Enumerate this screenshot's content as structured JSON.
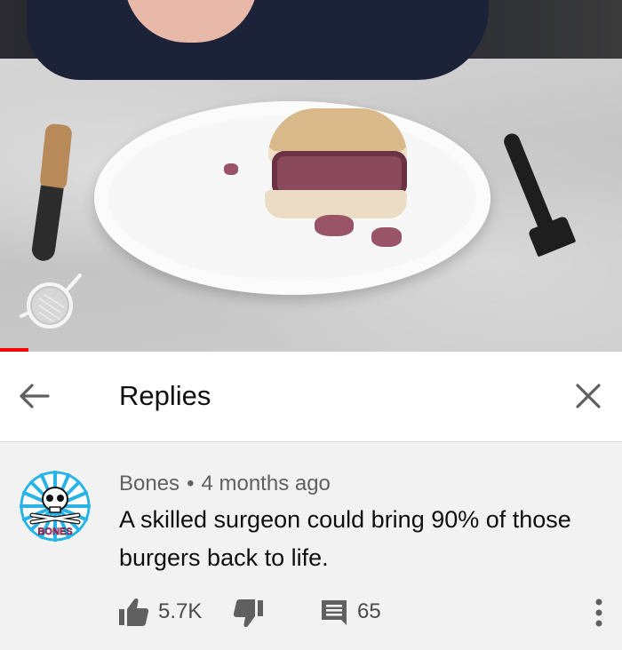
{
  "video": {
    "progress_fraction": 0.046
  },
  "replies_header": {
    "title": "Replies",
    "back_icon": "arrow-left-icon",
    "close_icon": "close-icon"
  },
  "comment": {
    "author": "Bones",
    "separator": "•",
    "time_ago": "4 months ago",
    "text": "A skilled surgeon could bring 90% of those burgers back to life.",
    "avatar_text": "BONES",
    "like_count": "5.7K",
    "reply_count": "65",
    "icons": {
      "like": "thumbs-up-icon",
      "dislike": "thumbs-down-icon",
      "reply": "comment-icon",
      "more": "more-vertical-icon"
    }
  },
  "colors": {
    "progress": "#ff0000",
    "header_bg": "#ffffff",
    "comment_bg": "#f2f2f2",
    "secondary_text": "#606060",
    "avatar_ring": "#2ab3e6"
  }
}
